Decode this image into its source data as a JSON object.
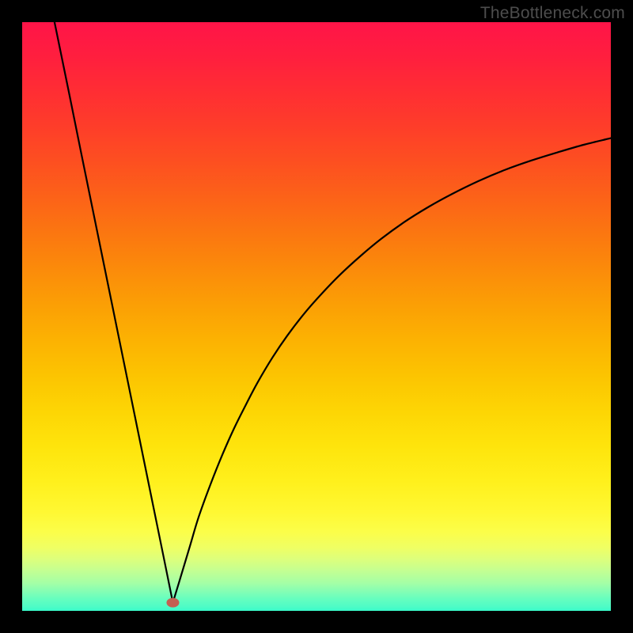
{
  "watermark": {
    "text": "TheBottleneck.com"
  },
  "gradient": {
    "stops": [
      {
        "offset": 0.0,
        "color": "#ff1448"
      },
      {
        "offset": 0.06,
        "color": "#ff1f3e"
      },
      {
        "offset": 0.12,
        "color": "#ff2e33"
      },
      {
        "offset": 0.18,
        "color": "#fe3e29"
      },
      {
        "offset": 0.24,
        "color": "#fd5020"
      },
      {
        "offset": 0.3,
        "color": "#fc6318"
      },
      {
        "offset": 0.36,
        "color": "#fb7710"
      },
      {
        "offset": 0.42,
        "color": "#fb8b0a"
      },
      {
        "offset": 0.48,
        "color": "#fb9f05"
      },
      {
        "offset": 0.54,
        "color": "#fcb202"
      },
      {
        "offset": 0.6,
        "color": "#fcc401"
      },
      {
        "offset": 0.66,
        "color": "#fdd504"
      },
      {
        "offset": 0.72,
        "color": "#fee40c"
      },
      {
        "offset": 0.78,
        "color": "#fff01c"
      },
      {
        "offset": 0.833,
        "color": "#fff833"
      },
      {
        "offset": 0.867,
        "color": "#fbfe4a"
      },
      {
        "offset": 0.893,
        "color": "#efff64"
      },
      {
        "offset": 0.913,
        "color": "#dcff7d"
      },
      {
        "offset": 0.933,
        "color": "#c2ff93"
      },
      {
        "offset": 0.953,
        "color": "#a4ffa6"
      },
      {
        "offset": 0.967,
        "color": "#84feb4"
      },
      {
        "offset": 0.98,
        "color": "#65febf"
      },
      {
        "offset": 0.993,
        "color": "#4efcc6"
      },
      {
        "offset": 1.0,
        "color": "#39fbca"
      }
    ]
  },
  "marker": {
    "x_frac": 0.256,
    "y_frac": 0.986,
    "color": "#c36052"
  },
  "chart_data": {
    "type": "line",
    "title": "",
    "xlabel": "",
    "ylabel": "",
    "xlim": [
      0.0,
      1.0
    ],
    "ylim": [
      0.0,
      1.0
    ],
    "note": "x and y are fractions of the plot area (origin top-left, y increases downward).",
    "series": [
      {
        "name": "bottleneck-curve-left",
        "x": [
          0.055,
          0.08,
          0.1,
          0.12,
          0.14,
          0.16,
          0.18,
          0.2,
          0.22,
          0.24,
          0.256
        ],
        "y": [
          0.0,
          0.122,
          0.221,
          0.319,
          0.417,
          0.515,
          0.613,
          0.711,
          0.809,
          0.907,
          0.986
        ]
      },
      {
        "name": "bottleneck-curve-right",
        "x": [
          0.256,
          0.27,
          0.285,
          0.3,
          0.32,
          0.34,
          0.36,
          0.38,
          0.4,
          0.425,
          0.45,
          0.48,
          0.51,
          0.54,
          0.575,
          0.61,
          0.65,
          0.69,
          0.73,
          0.775,
          0.82,
          0.865,
          0.91,
          0.955,
          1.0
        ],
        "y": [
          0.986,
          0.94,
          0.89,
          0.84,
          0.785,
          0.735,
          0.69,
          0.65,
          0.612,
          0.57,
          0.533,
          0.494,
          0.46,
          0.429,
          0.397,
          0.368,
          0.339,
          0.314,
          0.292,
          0.27,
          0.251,
          0.235,
          0.221,
          0.208,
          0.197
        ]
      }
    ],
    "marker_point": {
      "x": 0.256,
      "y": 0.986
    }
  }
}
